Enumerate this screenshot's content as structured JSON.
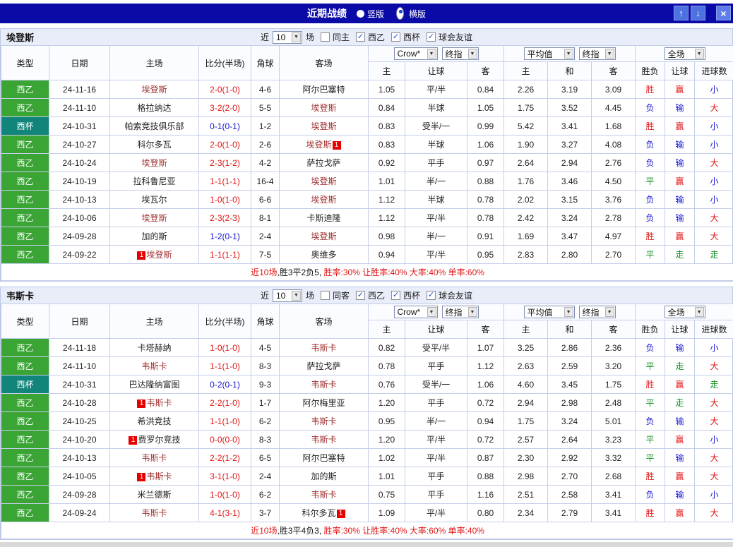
{
  "colors": {
    "win": "#e21717",
    "draw": "#0f9022",
    "loss": "#1414d2",
    "focal": "#a03030",
    "badge": "#e60000"
  },
  "titlebar": {
    "title": "近期战绩",
    "views": [
      {
        "label": "竖版",
        "selected": false
      },
      {
        "label": "横版",
        "selected": true
      }
    ],
    "buttons": {
      "up": "↑",
      "down": "↓",
      "close": "×"
    }
  },
  "tables": [
    {
      "team": "埃登斯",
      "filter": {
        "near": "近",
        "count": "10",
        "unit": "场",
        "same": {
          "label": "同主",
          "checked": false
        },
        "leagues": [
          {
            "label": "西乙",
            "checked": true
          },
          {
            "label": "西杯",
            "checked": true
          },
          {
            "label": "球会友谊",
            "checked": true
          }
        ]
      },
      "header": {
        "cols": [
          "类型",
          "日期",
          "主场",
          "比分(半场)",
          "角球",
          "客场"
        ],
        "odds_group": {
          "selects": [
            "Crow*",
            "终指"
          ]
        },
        "avg_group": {
          "selects": [
            "平均值",
            "终指"
          ]
        },
        "result_group": {
          "selects": [
            "全场"
          ]
        },
        "sub": [
          "主",
          "让球",
          "客",
          "主",
          "和",
          "客",
          "胜负",
          "让球",
          "进球数"
        ]
      },
      "rows": [
        {
          "league": "西乙",
          "cup": false,
          "date": "24-11-16",
          "home": {
            "name": "埃登斯",
            "focal": true
          },
          "score": "2-0(1-0)",
          "score_color": "red",
          "corner": "4-6",
          "away": {
            "name": "阿尔巴塞特",
            "focal": false
          },
          "odds": [
            "1.05",
            "平/半",
            "0.84"
          ],
          "avg": [
            "2.26",
            "3.19",
            "3.09"
          ],
          "res": [
            [
              "胜",
              "win"
            ],
            [
              "赢",
              "win"
            ],
            [
              "小",
              "loss"
            ]
          ]
        },
        {
          "league": "西乙",
          "cup": false,
          "date": "24-11-10",
          "home": {
            "name": "格拉纳达",
            "focal": false
          },
          "score": "3-2(2-0)",
          "score_color": "red",
          "corner": "5-5",
          "away": {
            "name": "埃登斯",
            "focal": true
          },
          "odds": [
            "0.84",
            "半球",
            "1.05"
          ],
          "avg": [
            "1.75",
            "3.52",
            "4.45"
          ],
          "res": [
            [
              "负",
              "loss"
            ],
            [
              "输",
              "loss"
            ],
            [
              "大",
              "win"
            ]
          ]
        },
        {
          "league": "西杯",
          "cup": true,
          "date": "24-10-31",
          "home": {
            "name": "帕索竞技俱乐部",
            "focal": false
          },
          "score": "0-1(0-1)",
          "score_color": "blue",
          "corner": "1-2",
          "away": {
            "name": "埃登斯",
            "focal": true
          },
          "odds": [
            "0.83",
            "受半/一",
            "0.99"
          ],
          "avg": [
            "5.42",
            "3.41",
            "1.68"
          ],
          "res": [
            [
              "胜",
              "win"
            ],
            [
              "赢",
              "win"
            ],
            [
              "小",
              "loss"
            ]
          ]
        },
        {
          "league": "西乙",
          "cup": false,
          "date": "24-10-27",
          "home": {
            "name": "科尔多瓦",
            "focal": false
          },
          "score": "2-0(1-0)",
          "score_color": "red",
          "corner": "2-6",
          "away": {
            "name": "埃登斯",
            "focal": true,
            "badge": "1",
            "badge_pos": "after"
          },
          "odds": [
            "0.83",
            "半球",
            "1.06"
          ],
          "avg": [
            "1.90",
            "3.27",
            "4.08"
          ],
          "res": [
            [
              "负",
              "loss"
            ],
            [
              "输",
              "loss"
            ],
            [
              "小",
              "loss"
            ]
          ]
        },
        {
          "league": "西乙",
          "cup": false,
          "date": "24-10-24",
          "home": {
            "name": "埃登斯",
            "focal": true
          },
          "score": "2-3(1-2)",
          "score_color": "red",
          "corner": "4-2",
          "away": {
            "name": "萨拉戈萨",
            "focal": false
          },
          "odds": [
            "0.92",
            "平手",
            "0.97"
          ],
          "avg": [
            "2.64",
            "2.94",
            "2.76"
          ],
          "res": [
            [
              "负",
              "loss"
            ],
            [
              "输",
              "loss"
            ],
            [
              "大",
              "win"
            ]
          ]
        },
        {
          "league": "西乙",
          "cup": false,
          "date": "24-10-19",
          "home": {
            "name": "拉科鲁尼亚",
            "focal": false
          },
          "score": "1-1(1-1)",
          "score_color": "red",
          "corner": "16-4",
          "away": {
            "name": "埃登斯",
            "focal": true
          },
          "odds": [
            "1.01",
            "半/一",
            "0.88"
          ],
          "avg": [
            "1.76",
            "3.46",
            "4.50"
          ],
          "res": [
            [
              "平",
              "draw"
            ],
            [
              "赢",
              "win"
            ],
            [
              "小",
              "loss"
            ]
          ]
        },
        {
          "league": "西乙",
          "cup": false,
          "date": "24-10-13",
          "home": {
            "name": "埃瓦尔",
            "focal": false
          },
          "score": "1-0(1-0)",
          "score_color": "red",
          "corner": "6-6",
          "away": {
            "name": "埃登斯",
            "focal": true
          },
          "odds": [
            "1.12",
            "半球",
            "0.78"
          ],
          "avg": [
            "2.02",
            "3.15",
            "3.76"
          ],
          "res": [
            [
              "负",
              "loss"
            ],
            [
              "输",
              "loss"
            ],
            [
              "小",
              "loss"
            ]
          ]
        },
        {
          "league": "西乙",
          "cup": false,
          "date": "24-10-06",
          "home": {
            "name": "埃登斯",
            "focal": true
          },
          "score": "2-3(2-3)",
          "score_color": "red",
          "corner": "8-1",
          "away": {
            "name": "卡斯迪隆",
            "focal": false
          },
          "odds": [
            "1.12",
            "平/半",
            "0.78"
          ],
          "avg": [
            "2.42",
            "3.24",
            "2.78"
          ],
          "res": [
            [
              "负",
              "loss"
            ],
            [
              "输",
              "loss"
            ],
            [
              "大",
              "win"
            ]
          ]
        },
        {
          "league": "西乙",
          "cup": false,
          "date": "24-09-28",
          "home": {
            "name": "加的斯",
            "focal": false
          },
          "score": "1-2(0-1)",
          "score_color": "blue",
          "corner": "2-4",
          "away": {
            "name": "埃登斯",
            "focal": true
          },
          "odds": [
            "0.98",
            "半/一",
            "0.91"
          ],
          "avg": [
            "1.69",
            "3.47",
            "4.97"
          ],
          "res": [
            [
              "胜",
              "win"
            ],
            [
              "赢",
              "win"
            ],
            [
              "大",
              "win"
            ]
          ]
        },
        {
          "league": "西乙",
          "cup": false,
          "date": "24-09-22",
          "home": {
            "name": "埃登斯",
            "focal": true,
            "badge": "1",
            "badge_pos": "before"
          },
          "score": "1-1(1-1)",
          "score_color": "red",
          "corner": "7-5",
          "away": {
            "name": "奥维多",
            "focal": false
          },
          "odds": [
            "0.94",
            "平/半",
            "0.95"
          ],
          "avg": [
            "2.83",
            "2.80",
            "2.70"
          ],
          "res": [
            [
              "平",
              "draw"
            ],
            [
              "走",
              "draw"
            ],
            [
              "走",
              "draw"
            ]
          ]
        }
      ],
      "summary": [
        [
          "近10场",
          "red"
        ],
        [
          ",胜3平2负5, ",
          "black"
        ],
        [
          "胜率:30% ",
          "red"
        ],
        [
          "让胜率:40% ",
          "red"
        ],
        [
          "大率:40% ",
          "red"
        ],
        [
          "单率:60%",
          "red"
        ]
      ]
    },
    {
      "team": "韦斯卡",
      "filter": {
        "near": "近",
        "count": "10",
        "unit": "场",
        "same": {
          "label": "同客",
          "checked": false
        },
        "leagues": [
          {
            "label": "西乙",
            "checked": true
          },
          {
            "label": "西杯",
            "checked": true
          },
          {
            "label": "球会友谊",
            "checked": true
          }
        ]
      },
      "header": {
        "cols": [
          "类型",
          "日期",
          "主场",
          "比分(半场)",
          "角球",
          "客场"
        ],
        "odds_group": {
          "selects": [
            "Crow*",
            "终指"
          ]
        },
        "avg_group": {
          "selects": [
            "平均值",
            "终指"
          ]
        },
        "result_group": {
          "selects": [
            "全场"
          ]
        },
        "sub": [
          "主",
          "让球",
          "客",
          "主",
          "和",
          "客",
          "胜负",
          "让球",
          "进球数"
        ]
      },
      "rows": [
        {
          "league": "西乙",
          "cup": false,
          "date": "24-11-18",
          "home": {
            "name": "卡塔赫纳",
            "focal": false
          },
          "score": "1-0(1-0)",
          "score_color": "red",
          "corner": "4-5",
          "away": {
            "name": "韦斯卡",
            "focal": true
          },
          "odds": [
            "0.82",
            "受平/半",
            "1.07"
          ],
          "avg": [
            "3.25",
            "2.86",
            "2.36"
          ],
          "res": [
            [
              "负",
              "loss"
            ],
            [
              "输",
              "loss"
            ],
            [
              "小",
              "loss"
            ]
          ]
        },
        {
          "league": "西乙",
          "cup": false,
          "date": "24-11-10",
          "home": {
            "name": "韦斯卡",
            "focal": true
          },
          "score": "1-1(1-0)",
          "score_color": "red",
          "corner": "8-3",
          "away": {
            "name": "萨拉戈萨",
            "focal": false
          },
          "odds": [
            "0.78",
            "平手",
            "1.12"
          ],
          "avg": [
            "2.63",
            "2.59",
            "3.20"
          ],
          "res": [
            [
              "平",
              "draw"
            ],
            [
              "走",
              "draw"
            ],
            [
              "大",
              "win"
            ]
          ]
        },
        {
          "league": "西杯",
          "cup": true,
          "date": "24-10-31",
          "home": {
            "name": "巴达隆纳富图",
            "focal": false
          },
          "score": "0-2(0-1)",
          "score_color": "blue",
          "corner": "9-3",
          "away": {
            "name": "韦斯卡",
            "focal": true
          },
          "odds": [
            "0.76",
            "受半/一",
            "1.06"
          ],
          "avg": [
            "4.60",
            "3.45",
            "1.75"
          ],
          "res": [
            [
              "胜",
              "win"
            ],
            [
              "赢",
              "win"
            ],
            [
              "走",
              "draw"
            ]
          ]
        },
        {
          "league": "西乙",
          "cup": false,
          "date": "24-10-28",
          "home": {
            "name": "韦斯卡",
            "focal": true,
            "badge": "1",
            "badge_pos": "before"
          },
          "score": "2-2(1-0)",
          "score_color": "red",
          "corner": "1-7",
          "away": {
            "name": "阿尔梅里亚",
            "focal": false
          },
          "odds": [
            "1.20",
            "平手",
            "0.72"
          ],
          "avg": [
            "2.94",
            "2.98",
            "2.48"
          ],
          "res": [
            [
              "平",
              "draw"
            ],
            [
              "走",
              "draw"
            ],
            [
              "大",
              "win"
            ]
          ]
        },
        {
          "league": "西乙",
          "cup": false,
          "date": "24-10-25",
          "home": {
            "name": "希洪竞技",
            "focal": false
          },
          "score": "1-1(1-0)",
          "score_color": "red",
          "corner": "6-2",
          "away": {
            "name": "韦斯卡",
            "focal": true
          },
          "odds": [
            "0.95",
            "半/一",
            "0.94"
          ],
          "avg": [
            "1.75",
            "3.24",
            "5.01"
          ],
          "res": [
            [
              "负",
              "loss"
            ],
            [
              "输",
              "loss"
            ],
            [
              "大",
              "win"
            ]
          ]
        },
        {
          "league": "西乙",
          "cup": false,
          "date": "24-10-20",
          "home": {
            "name": "费罗尔竞技",
            "focal": false,
            "badge": "1",
            "badge_pos": "before"
          },
          "score": "0-0(0-0)",
          "score_color": "red",
          "corner": "8-3",
          "away": {
            "name": "韦斯卡",
            "focal": true
          },
          "odds": [
            "1.20",
            "平/半",
            "0.72"
          ],
          "avg": [
            "2.57",
            "2.64",
            "3.23"
          ],
          "res": [
            [
              "平",
              "draw"
            ],
            [
              "赢",
              "win"
            ],
            [
              "小",
              "loss"
            ]
          ]
        },
        {
          "league": "西乙",
          "cup": false,
          "date": "24-10-13",
          "home": {
            "name": "韦斯卡",
            "focal": true
          },
          "score": "2-2(1-2)",
          "score_color": "red",
          "corner": "6-5",
          "away": {
            "name": "阿尔巴塞特",
            "focal": false
          },
          "odds": [
            "1.02",
            "平/半",
            "0.87"
          ],
          "avg": [
            "2.30",
            "2.92",
            "3.32"
          ],
          "res": [
            [
              "平",
              "draw"
            ],
            [
              "输",
              "loss"
            ],
            [
              "大",
              "win"
            ]
          ]
        },
        {
          "league": "西乙",
          "cup": false,
          "date": "24-10-05",
          "home": {
            "name": "韦斯卡",
            "focal": true,
            "badge": "1",
            "badge_pos": "before"
          },
          "score": "3-1(1-0)",
          "score_color": "red",
          "corner": "2-4",
          "away": {
            "name": "加的斯",
            "focal": false
          },
          "odds": [
            "1.01",
            "平手",
            "0.88"
          ],
          "avg": [
            "2.98",
            "2.70",
            "2.68"
          ],
          "res": [
            [
              "胜",
              "win"
            ],
            [
              "赢",
              "win"
            ],
            [
              "大",
              "win"
            ]
          ]
        },
        {
          "league": "西乙",
          "cup": false,
          "date": "24-09-28",
          "home": {
            "name": "米兰德斯",
            "focal": false
          },
          "score": "1-0(1-0)",
          "score_color": "red",
          "corner": "6-2",
          "away": {
            "name": "韦斯卡",
            "focal": true
          },
          "odds": [
            "0.75",
            "平手",
            "1.16"
          ],
          "avg": [
            "2.51",
            "2.58",
            "3.41"
          ],
          "res": [
            [
              "负",
              "loss"
            ],
            [
              "输",
              "loss"
            ],
            [
              "小",
              "loss"
            ]
          ]
        },
        {
          "league": "西乙",
          "cup": false,
          "date": "24-09-24",
          "home": {
            "name": "韦斯卡",
            "focal": true
          },
          "score": "4-1(3-1)",
          "score_color": "red",
          "corner": "3-7",
          "away": {
            "name": "科尔多瓦",
            "focal": false,
            "badge": "1",
            "badge_pos": "after"
          },
          "odds": [
            "1.09",
            "平/半",
            "0.80"
          ],
          "avg": [
            "2.34",
            "2.79",
            "3.41"
          ],
          "res": [
            [
              "胜",
              "win"
            ],
            [
              "赢",
              "win"
            ],
            [
              "大",
              "win"
            ]
          ]
        }
      ],
      "summary": [
        [
          "近10场",
          "red"
        ],
        [
          ",胜3平4负3, ",
          "black"
        ],
        [
          "胜率:30% ",
          "red"
        ],
        [
          "让胜率:40% ",
          "red"
        ],
        [
          "大率:60% ",
          "red"
        ],
        [
          "单率:40%",
          "red"
        ]
      ]
    }
  ]
}
